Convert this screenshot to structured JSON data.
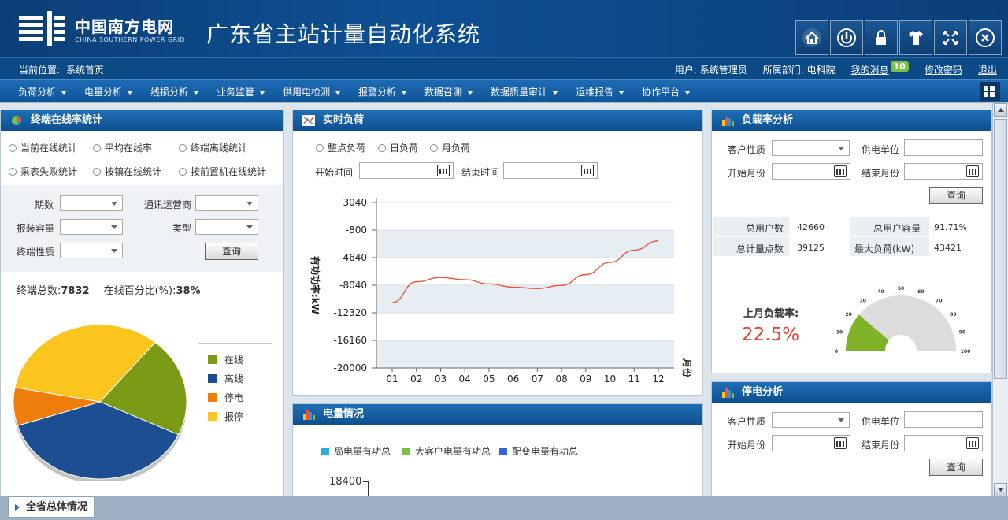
{
  "header": {
    "logo_cn": "中国南方电网",
    "logo_en": "CHINA SOUTHERN POWER GRID",
    "title": "广东省主站计量自动化系统",
    "tools": [
      "home-icon",
      "power-icon",
      "lock-icon",
      "shirt-icon",
      "fullscreen-icon",
      "close-icon"
    ]
  },
  "userbar": {
    "location_label": "当前位置:",
    "location": "系统首页",
    "user": "用户: 系统管理员",
    "dept": "所属部门: 电科院",
    "messages": "我的消息",
    "message_count": "10",
    "change_password": "修改密码",
    "logout": "退出"
  },
  "menu": [
    "负荷分析",
    "电量分析",
    "线损分析",
    "业务监管",
    "供用电检测",
    "报警分析",
    "数据召测",
    "数据质量审计",
    "运维报告",
    "协作平台"
  ],
  "online_panel": {
    "title": "终端在线率统计",
    "radios": [
      "当前在线统计",
      "平均在线率",
      "终端离线统计",
      "采表失败统计",
      "按镇在线统计",
      "按前置机在线统计"
    ],
    "f_period": "期数",
    "f_carrier": "通讯运营商",
    "f_capacity": "报装容量",
    "f_type": "类型",
    "f_nature": "终端性质",
    "query": "查询",
    "total_label": "终端总数:",
    "total": "7832",
    "pct_label": "在线百分比(%):",
    "pct": "38%",
    "pie": [
      {
        "name": "在线",
        "color": "#7b9a16",
        "value": 21
      },
      {
        "name": "离线",
        "color": "#1c4f91",
        "value": 38
      },
      {
        "name": "停电",
        "color": "#ee7d0b",
        "value": 8
      },
      {
        "name": "报停",
        "color": "#fcc51e",
        "value": 33
      }
    ]
  },
  "realtime_panel": {
    "title": "实时负荷",
    "radios": [
      "整点负荷",
      "日负荷",
      "月负荷"
    ],
    "start_label": "开始时间",
    "end_label": "结束时间",
    "chart_data": {
      "type": "line",
      "ylabel": "有功功率:kW",
      "xlabel": "月份",
      "y_ticks": [
        "3040",
        "-800",
        "-4640",
        "-8040",
        "-12320",
        "-16160",
        "-20000"
      ],
      "ylim": [
        -20000,
        3040
      ],
      "categories": [
        "01",
        "02",
        "03",
        "04",
        "05",
        "06",
        "07",
        "08",
        "09",
        "10",
        "11",
        "12"
      ],
      "series": [
        {
          "color": "#e8553e",
          "values": [
            -10900,
            -8000,
            -7400,
            -7700,
            -8300,
            -8750,
            -8950,
            -8500,
            -7000,
            -5300,
            -3600,
            -2300
          ]
        }
      ]
    }
  },
  "energy_panel": {
    "title": "电量情况",
    "legend": [
      {
        "name": "局电量有功总",
        "color": "#23b3dc"
      },
      {
        "name": "大客户电量有功总",
        "color": "#7bc142"
      },
      {
        "name": "配变电量有功总",
        "color": "#3461e0"
      }
    ],
    "y_top": "18400"
  },
  "loadrate_panel": {
    "title": "负载率分析",
    "f_customer": "客户性质",
    "f_supply": "供电单位",
    "f_start": "开始月份",
    "f_end": "结束月份",
    "query": "查询",
    "total_users_label": "总用户数",
    "total_users": "42660",
    "total_capacity_label": "总用户容量",
    "total_capacity": "91.71%",
    "meter_points_label": "总计量点数",
    "meter_points": "39125",
    "max_load_label": "最大负荷(kW)",
    "max_load": "43421",
    "last_month_label": "上月负载率:",
    "last_month": "22.5%",
    "gauge_ticks": [
      "0",
      "10",
      "20",
      "30",
      "40",
      "50",
      "60",
      "70",
      "80",
      "90",
      "100"
    ],
    "gauge_value": 22.5
  },
  "outage_panel": {
    "title": "停电分析",
    "f_customer": "客户性质",
    "f_supply": "供电单位",
    "f_start": "开始月份",
    "f_end": "结束月份",
    "query": "查询"
  },
  "bottom": {
    "tab": "全省总体情况"
  }
}
